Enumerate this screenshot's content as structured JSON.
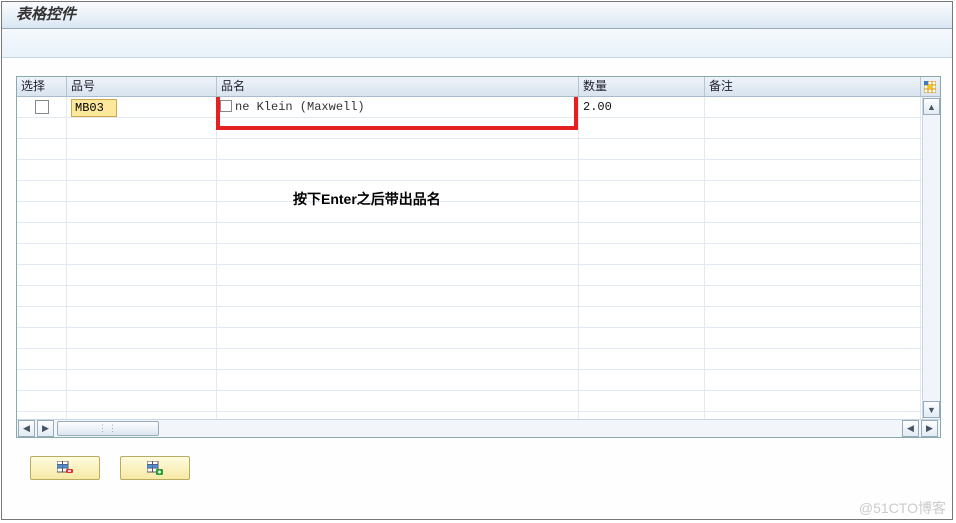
{
  "window": {
    "title": "表格控件"
  },
  "table": {
    "columns": {
      "select": "选择",
      "code": "品号",
      "name": "品名",
      "qty": "数量",
      "note": "备注"
    },
    "row": {
      "code": "MB03",
      "name": "ne Klein (Maxwell)",
      "qty": "2.00",
      "note": ""
    }
  },
  "annotation": {
    "text": "按下Enter之后带出品名"
  },
  "buttons": {
    "delete_row": "delete-row",
    "insert_row": "insert-row"
  },
  "watermark": "@51CTO博客"
}
